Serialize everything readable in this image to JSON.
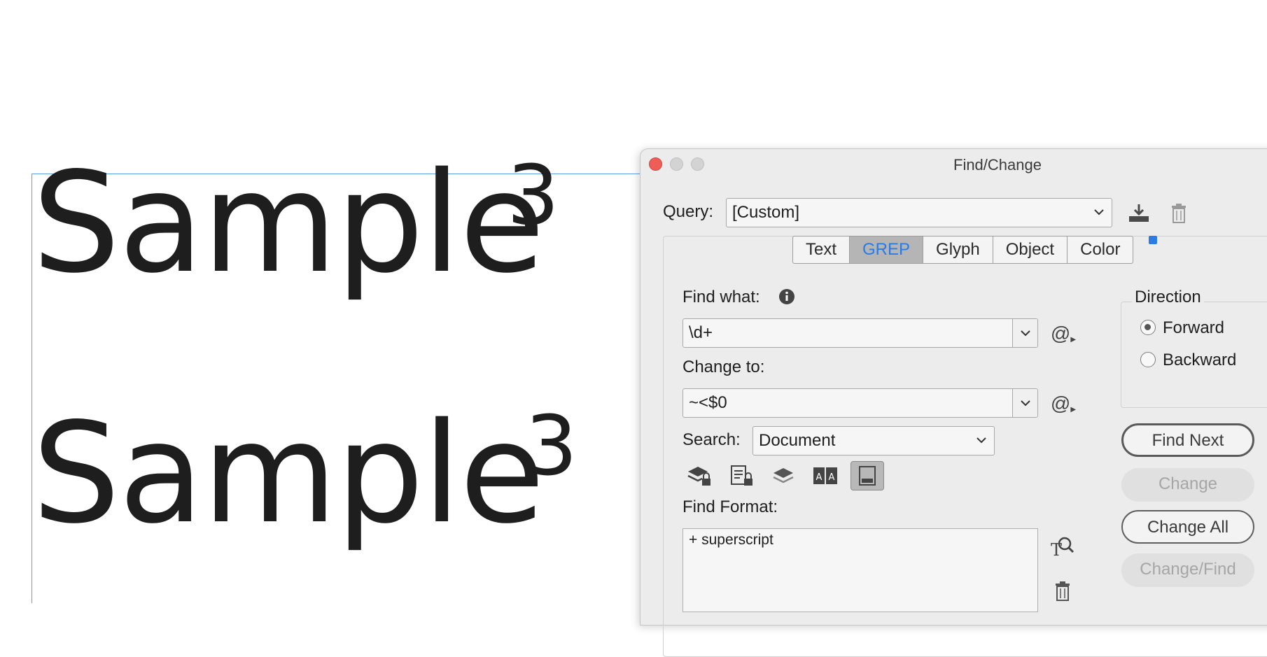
{
  "document": {
    "sample1_text": "Sample",
    "sample1_sup": "3",
    "sample2_text": "Sample",
    "sample2_sup": "3"
  },
  "dialog": {
    "title": "Find/Change",
    "query_label": "Query:",
    "query_value": "[Custom]",
    "tabs": [
      "Text",
      "GREP",
      "Glyph",
      "Object",
      "Color"
    ],
    "active_tab": "GREP",
    "find_what_label": "Find what:",
    "find_what_value": "\\d+",
    "change_to_label": "Change to:",
    "change_to_value": "~<$0",
    "search_label": "Search:",
    "search_value": "Document",
    "direction_label": "Direction",
    "direction_forward": "Forward",
    "direction_backward": "Backward",
    "direction_selected": "Forward",
    "find_format_label": "Find Format:",
    "find_format_value": "+ superscript",
    "buttons": {
      "find_next": "Find Next",
      "change": "Change",
      "change_all": "Change All",
      "change_find": "Change/Find"
    },
    "special_char_symbol": "@"
  },
  "colors": {
    "accent": "#2a7be4",
    "close": "#ee5e57",
    "frame_guide": "#5b9ee8"
  }
}
